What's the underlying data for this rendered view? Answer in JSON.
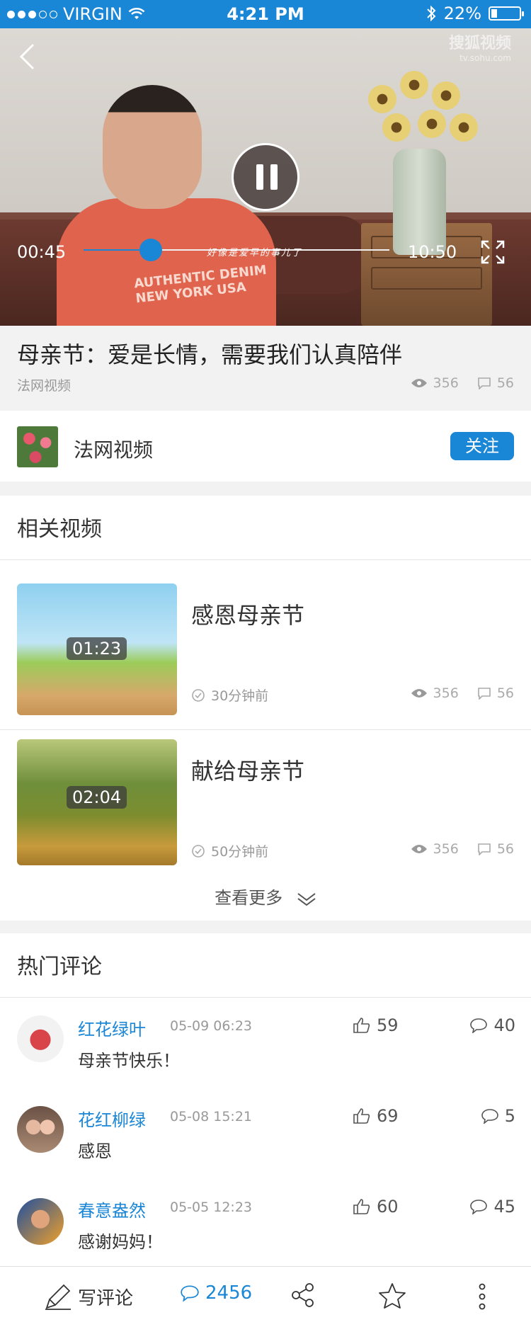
{
  "status_bar": {
    "carrier": "VIRGIN",
    "time": "4:21 PM",
    "battery": "22%",
    "battery_level": 0.22
  },
  "video": {
    "watermark": "搜狐视频",
    "watermark_sub": "tv.sohu.com",
    "shirt_text": "AUTHENTIC DENIM NEW YORK USA",
    "subtitle": "好像是爱早的事儿了",
    "current_time": "00:45",
    "total_time": "10:50",
    "progress": 0.22
  },
  "title_block": {
    "title": "母亲节：爱是长情，需要我们认真陪伴",
    "source": "法网视频",
    "views": "356",
    "comments": "56"
  },
  "channel": {
    "name": "法网视频",
    "follow_label": "关注"
  },
  "related": {
    "heading": "相关视频",
    "items": [
      {
        "title": "感恩母亲节",
        "duration": "01:23",
        "time": "30分钟前",
        "views": "356",
        "comments": "56"
      },
      {
        "title": "献给母亲节",
        "duration": "02:04",
        "time": "50分钟前",
        "views": "356",
        "comments": "56"
      }
    ],
    "see_more": "查看更多"
  },
  "comments": {
    "heading": "热门评论",
    "items": [
      {
        "user": "红花绿叶",
        "date": "05-09 06:23",
        "likes": "59",
        "replies": "40",
        "text": "母亲节快乐！"
      },
      {
        "user": "花红柳绿",
        "date": "05-08 15:21",
        "likes": "69",
        "replies": "5",
        "text": "感恩"
      },
      {
        "user": "春意盎然",
        "date": "05-05 12:23",
        "likes": "60",
        "replies": "45",
        "text": "感谢妈妈！"
      }
    ]
  },
  "toolbar": {
    "write_label": "写评论",
    "comment_count": "2456"
  },
  "colors": {
    "accent": "#1a86d6",
    "background": "#f2f2f2"
  }
}
